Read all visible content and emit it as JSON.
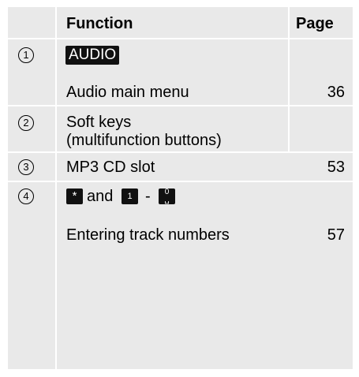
{
  "header": {
    "function": "Function",
    "page": "Page"
  },
  "rows": [
    {
      "num": "1",
      "key": "AUDIO",
      "desc": "Audio main menu",
      "page": "36"
    },
    {
      "num": "2",
      "desc_line1": "Soft keys",
      "desc_line2": "(multifunction buttons)",
      "page": ""
    },
    {
      "num": "3",
      "desc": "MP3 CD slot",
      "page": "53"
    },
    {
      "num": "4",
      "key_star": "*",
      "and": "and",
      "key_one": "1",
      "dash": "-",
      "key_zero": "0",
      "key_zero_sub": "␣",
      "desc": "Entering track numbers",
      "page": "57"
    }
  ]
}
